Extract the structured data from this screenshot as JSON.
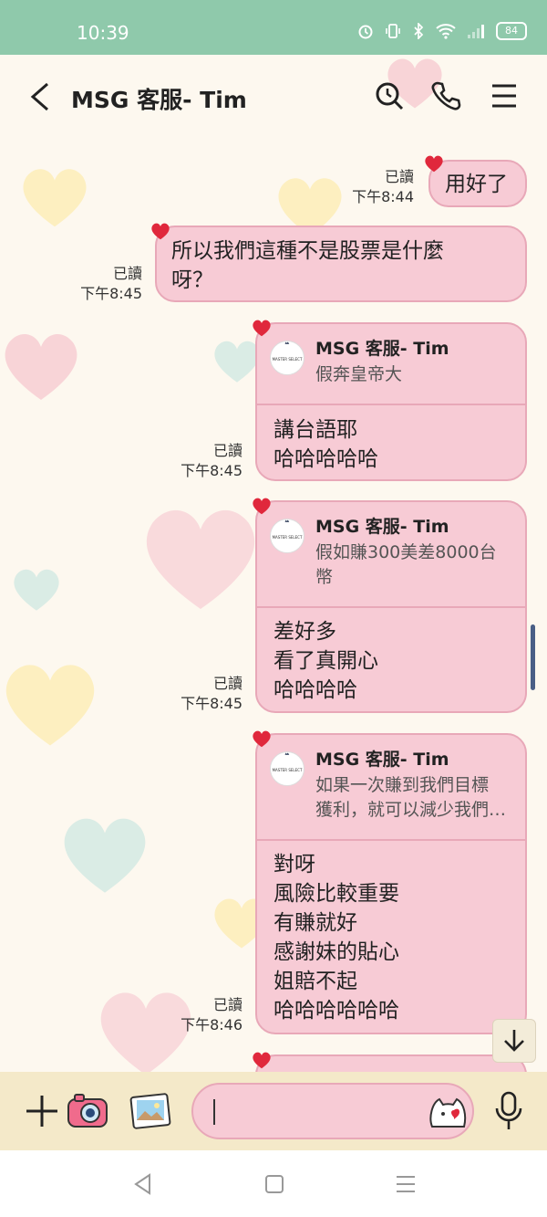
{
  "status_bar": {
    "time": "10:39",
    "battery": "84"
  },
  "header": {
    "title": "MSG 客服- Tim",
    "icons": [
      "back-arrow-icon",
      "search-icon",
      "phone-icon",
      "menu-icon"
    ]
  },
  "messages": [
    {
      "read_label": "已讀",
      "time": "下午8:44",
      "text": "用好了"
    },
    {
      "read_label": "已讀",
      "time": "下午8:45",
      "text_line1": "所以我們這種不是股票是什麼",
      "text_line2": "呀？"
    },
    {
      "read_label": "已讀",
      "time": "下午8:45",
      "reply_name": "MSG 客服- Tim",
      "reply_quote": "假奔皇帝大",
      "lines": [
        "講台語耶",
        "哈哈哈哈哈"
      ]
    },
    {
      "read_label": "已讀",
      "time": "下午8:45",
      "reply_name": "MSG 客服- Tim",
      "reply_quote_line1": "假如賺300美差8000台",
      "reply_quote_line2": "幣",
      "lines": [
        "差好多",
        "看了真開心",
        "哈哈哈哈"
      ]
    },
    {
      "read_label": "已讀",
      "time": "下午8:46",
      "reply_name": "MSG 客服- Tim",
      "reply_quote_line1": "如果一次賺到我們目標",
      "reply_quote_line2": "獲利，就可以減少我們…",
      "lines": [
        "對呀",
        "風險比較重要",
        "有賺就好",
        "感謝妹的貼心",
        "姐賠不起",
        "哈哈哈哈哈哈"
      ]
    }
  ],
  "avatar": {
    "logo_text": "MASTER SELECT"
  },
  "input": {
    "value": ""
  },
  "colors": {
    "status_bar": "#8fc9ab",
    "bubble": "#f7cbd5",
    "bubble_border": "#e8a8b8",
    "heart": "#e0283c",
    "input_bar": "#f4e9c9"
  }
}
